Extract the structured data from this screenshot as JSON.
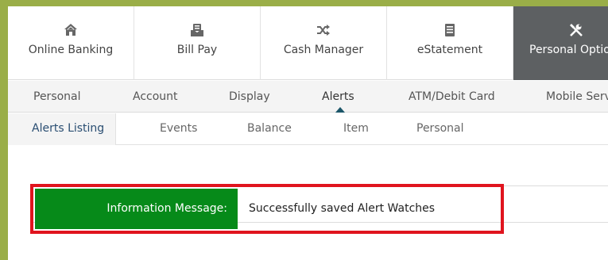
{
  "main_nav": {
    "items": [
      {
        "label": "Online Banking",
        "icon": "home-icon"
      },
      {
        "label": "Bill Pay",
        "icon": "bill-icon"
      },
      {
        "label": "Cash Manager",
        "icon": "shuffle-icon"
      },
      {
        "label": "eStatement",
        "icon": "document-icon"
      },
      {
        "label": "Personal Options",
        "icon": "tools-icon"
      }
    ],
    "active": "Personal Options"
  },
  "sub_nav": {
    "items": [
      "Personal",
      "Account",
      "Display",
      "Alerts",
      "ATM/Debit Card",
      "Mobile Services"
    ],
    "active": "Alerts"
  },
  "alerts_nav": {
    "items": [
      "Alerts Listing",
      "Events",
      "Balance",
      "Item",
      "Personal"
    ],
    "active": "Alerts Listing"
  },
  "message": {
    "label": "Information Message:",
    "text": "Successfully saved Alert Watches"
  },
  "colors": {
    "frame": "#9aae48",
    "active_tab": "#5d6062",
    "message_label_bg": "#068a19",
    "highlight_border": "#e0141e",
    "caret": "#1c5669"
  }
}
